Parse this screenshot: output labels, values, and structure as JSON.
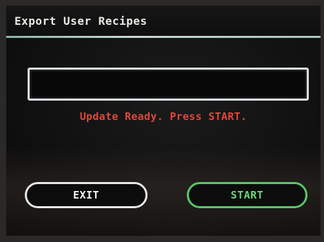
{
  "window": {
    "title": "Export User Recipes"
  },
  "main": {
    "field_value": "",
    "status_message": "Update Ready. Press START."
  },
  "buttons": {
    "exit_label": "EXIT",
    "start_label": "START"
  },
  "colors": {
    "status_text": "#e0463c",
    "start_accent": "#58c86a",
    "exit_outline": "#e7e7e7",
    "title_rule": "#c9d9cf"
  }
}
